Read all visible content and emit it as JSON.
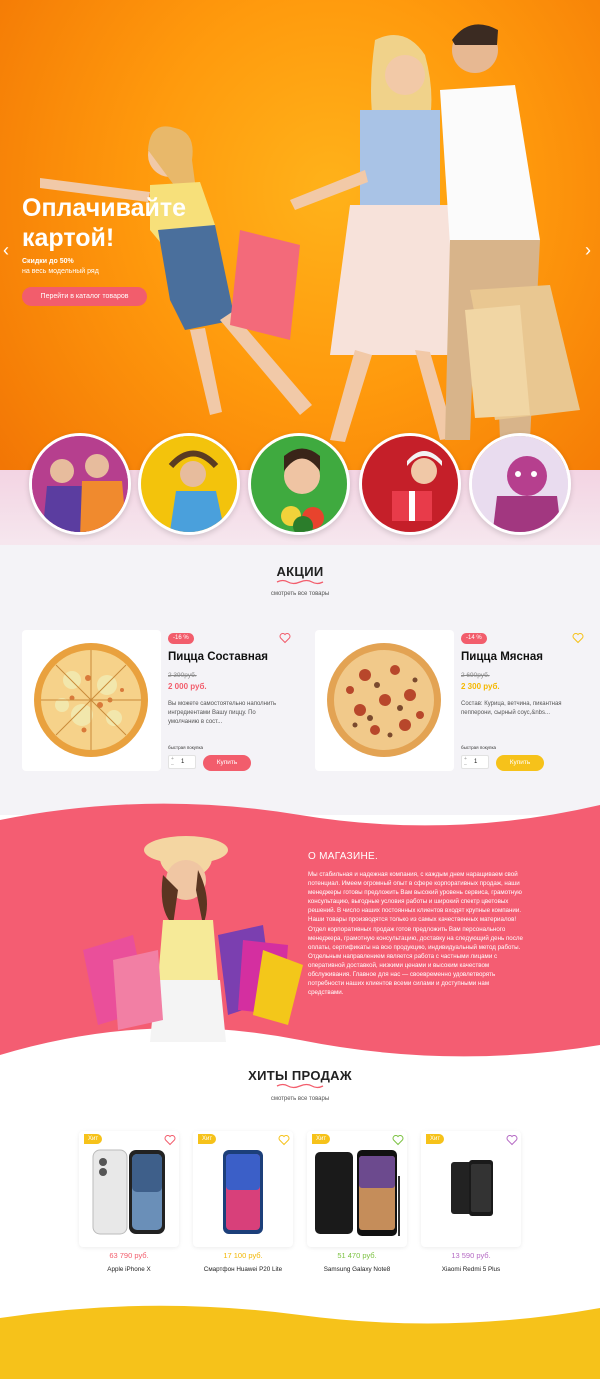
{
  "hero": {
    "title": "Оплачивайте картой!",
    "subtitle_line1": "Скидки до 50%",
    "subtitle_line2": "на весь модельный ряд",
    "button": "Перейти в каталог товаров",
    "prev_icon": "chevron-left-icon",
    "next_icon": "chevron-right-icon"
  },
  "promo": {
    "title": "АКЦИИ",
    "link": "смотреть все товары",
    "products": [
      {
        "badge": "-16 %",
        "name": "Пицца Составная",
        "old_price": "2 390руб.",
        "price": "2 000 руб.",
        "description": "Вы можете самостоятельно наполнить ингредиентами Вашу пиццу. По умолчанию в сост...",
        "quick_buy": "быстрая покупка",
        "qty": "1",
        "button": "Купить",
        "price_color": "#f25d6c",
        "button_color": "#f25d6c"
      },
      {
        "badge": "-14 %",
        "name": "Пицца Мясная",
        "old_price": "2 690руб.",
        "price": "2 300 руб.",
        "description": "Состав: Курица, ветчина, пикантная пепперони, сырный соус,&nbs...",
        "quick_buy": "быстрая покупка",
        "qty": "1",
        "button": "Купить",
        "price_color": "#f5b800",
        "button_color": "#f6c21a"
      }
    ]
  },
  "about": {
    "title": "О МАГАЗИНЕ.",
    "text": "Мы стабильная и надежная компания, с каждым днем наращиваем свой потенциал. Имеем огромный опыт в сфере корпоративных продаж, наши менеджеры готовы предложить Вам высокий уровень сервиса, грамотную консультацию, выгодные условия работы и широкий спектр цветовых решений. В число наших постоянных клиентов входят крупные компании. Наши товары производятся только из самых качественных материалов! Отдел корпоративных продаж готов предложить Вам персонального менеджера, грамотную консультацию, доставку на следующий день после оплаты, сертификаты на всю продукцию, индивидуальный метод работы. Отдельным направлением является работа с частными лицами с оперативной доставкой, низкими ценами и высоким качеством обслуживания. Главное для нас — своевременно удовлетворять потребности наших клиентов всеми силами и доступными нам средствами.",
    "bg_color": "#f45d72"
  },
  "hits": {
    "title": "ХИТЫ ПРОДАЖ",
    "link": "смотреть все товары",
    "products": [
      {
        "badge": "Хит",
        "price": "63 790 руб.",
        "name": "Apple iPhone X",
        "price_color": "#f25d6c"
      },
      {
        "badge": "Хит",
        "price": "17 100 руб.",
        "name": "Смартфон Huawei P20 Lite",
        "price_color": "#f2b705"
      },
      {
        "badge": "Хит",
        "price": "51 470 руб.",
        "name": "Samsung Galaxy Note8",
        "price_color": "#7cc242"
      },
      {
        "badge": "Хит",
        "price": "13 590 руб.",
        "name": "Xiaomi Redmi 5 Plus",
        "price_color": "#b56ac4"
      }
    ]
  }
}
